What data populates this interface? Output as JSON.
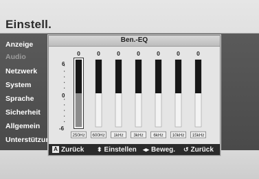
{
  "screen": {
    "title": "Einstell."
  },
  "menu": {
    "items": [
      {
        "label": "Anzeige",
        "active": false
      },
      {
        "label": "Audio",
        "active": true
      },
      {
        "label": "Netzwerk",
        "active": false
      },
      {
        "label": "System",
        "active": false
      },
      {
        "label": "Sprache",
        "active": false
      },
      {
        "label": "Sicherheit",
        "active": false
      },
      {
        "label": "Allgemein",
        "active": false
      },
      {
        "label": "Unterstützung",
        "active": false
      }
    ]
  },
  "dialog": {
    "title": "Ben.-EQ",
    "scale": {
      "top": "6",
      "mid": "0",
      "bottom": "-6"
    },
    "selected_band_index": 0
  },
  "equalizer": {
    "bands": [
      {
        "frequency": "250Hz",
        "value": 0
      },
      {
        "frequency": "600Hz",
        "value": 0
      },
      {
        "frequency": "1kHz",
        "value": 0
      },
      {
        "frequency": "3kHz",
        "value": 0
      },
      {
        "frequency": "6kHz",
        "value": 0
      },
      {
        "frequency": "10kHz",
        "value": 0
      },
      {
        "frequency": "15kHz",
        "value": 0
      }
    ],
    "min": -6,
    "max": 6
  },
  "hints": {
    "back_key": "A",
    "back": "Zurück",
    "adjust_icon": "up-down-arrows-icon",
    "adjust": "Einstellen",
    "move_icon": "left-right-arrows-icon",
    "move": "Beweg.",
    "return_icon": "return-icon",
    "return": "Zurück"
  },
  "colors": {
    "bar_fill": "#171717",
    "bar_empty": "#f3f3f3",
    "selected_fill": "#8c8c8c",
    "hint_bar": "#2b2b2b"
  }
}
